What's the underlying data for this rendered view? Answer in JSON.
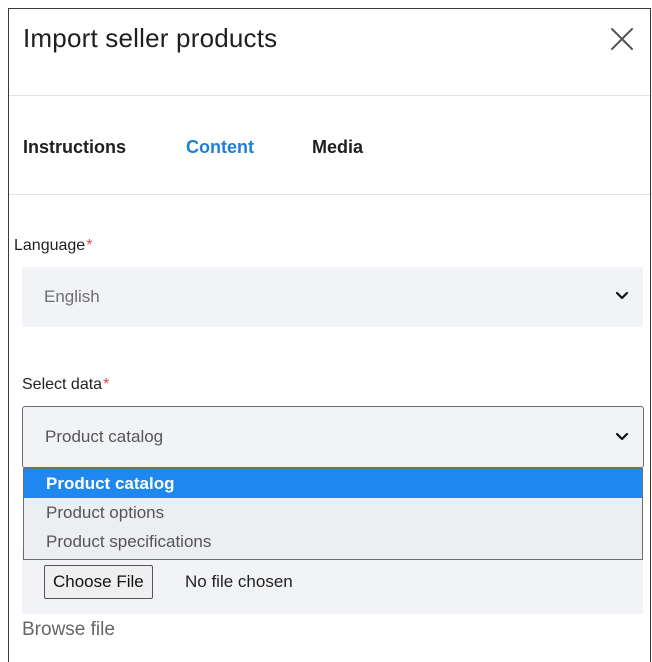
{
  "modal": {
    "title": "Import seller products"
  },
  "tabs": [
    {
      "label": "Instructions",
      "active": false
    },
    {
      "label": "Content",
      "active": true
    },
    {
      "label": "Media",
      "active": false
    }
  ],
  "language": {
    "label": "Language",
    "required_mark": "*",
    "selected": "English"
  },
  "select_data": {
    "label": "Select data",
    "required_mark": "*",
    "selected": "Product catalog",
    "options": [
      "Product catalog",
      "Product options",
      "Product specifications"
    ]
  },
  "file_input": {
    "button_label": "Choose File",
    "status": "No file chosen",
    "browse_label": "Browse file"
  },
  "colors": {
    "accent": "#1e7fd8",
    "highlight": "#1e88f0",
    "required": "#e5484d",
    "field_bg": "#f1f3f6"
  },
  "icons": {
    "close": "close-icon",
    "chevron": "chevron-down-icon"
  }
}
